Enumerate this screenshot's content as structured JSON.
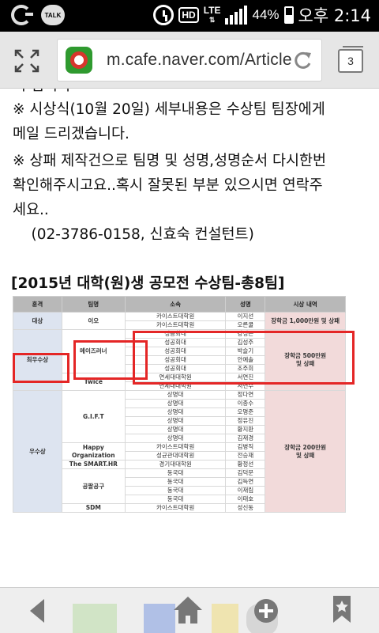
{
  "status_bar": {
    "talk_label": "TALK",
    "hd_label": "HD",
    "lte_label": "LTE",
    "battery": "44%",
    "time": "오후 2:14"
  },
  "browser": {
    "url": "m.cafe.naver.com/Article",
    "tab_count": "3"
  },
  "article": {
    "cutoff_line": "이 겁니다",
    "lines": [
      "※ 시상식(10월 20일) 세부내용은 수상팀 팀장에게",
      "메일 드리겠습니다.",
      "※ 상패 제작건으로 팀명 및 성명,성명순서 다시한번",
      "확인해주시고요..혹시 잘못된 부분 있으시면 연락주",
      "세요..",
      "    (02-3786-0158, 신효숙 컨설턴트)"
    ],
    "table_title": "[2015년 대학(원)생 공모전 수상팀-총8팀]"
  },
  "table": {
    "headers": [
      "훈격",
      "팀명",
      "소속",
      "성명",
      "시상 내역"
    ],
    "groups": [
      {
        "award": "대상",
        "prize": "장학금 1,000만원 및 상패",
        "teams": [
          {
            "name": "이오",
            "members": [
              [
                "카이스트대학원",
                "이지선"
              ],
              [
                "카이스트대학원",
                "오른쿨"
              ]
            ]
          }
        ]
      },
      {
        "award": "최우수상",
        "prize": "장학금 500만원\n및 상패",
        "teams": [
          {
            "name": "메이즈러너",
            "members": [
              [
                "성공회대",
                "강성근"
              ],
              [
                "성공회대",
                "김성주"
              ],
              [
                "성공회대",
                "박슬기"
              ],
              [
                "성공회대",
                "안예솔"
              ],
              [
                "성공회대",
                "조주희"
              ]
            ]
          },
          {
            "name": "Twice",
            "members": [
              [
                "연세대대학원",
                "서연진"
              ],
              [
                "연세대대학원",
                "서연수"
              ]
            ]
          }
        ]
      },
      {
        "award": "우수상",
        "prize": "장학금 200만원\n및 상패",
        "teams": [
          {
            "name": "G.I.F.T",
            "members": [
              [
                "상명대",
                "정다연"
              ],
              [
                "상명대",
                "이종수"
              ],
              [
                "상명대",
                "오명준"
              ],
              [
                "상명대",
                "정유진"
              ],
              [
                "상명대",
                "황지환"
              ],
              [
                "상명대",
                "김재경"
              ]
            ]
          },
          {
            "name": "Happy Organization",
            "members": [
              [
                "카이스트대학원",
                "김병직"
              ],
              [
                "성균관대대학원",
                "전승재"
              ]
            ]
          },
          {
            "name": "The SMART.HR",
            "members": [
              [
                "경기대대학원",
                "황정선"
              ]
            ]
          },
          {
            "name": "공팔공구",
            "members": [
              [
                "동국대",
                "김덕문"
              ],
              [
                "동국대",
                "김득연"
              ],
              [
                "동국대",
                "이재림"
              ],
              [
                "동국대",
                "이태호"
              ]
            ]
          },
          {
            "name": "SDM",
            "members": [
              [
                "카이스트대학원",
                "성신동"
              ]
            ]
          }
        ]
      }
    ]
  },
  "icons": {
    "fullscreen": "fullscreen-icon",
    "reload": "reload-icon",
    "back": "back-arrow-icon",
    "home": "home-icon",
    "add": "add-tab-icon",
    "bookmark": "bookmark-icon"
  },
  "colors": {
    "highlight": "#e42626",
    "award_cell": "#dde4f0",
    "prize_cell": "#f2dada",
    "header": "#b8b8b8"
  }
}
